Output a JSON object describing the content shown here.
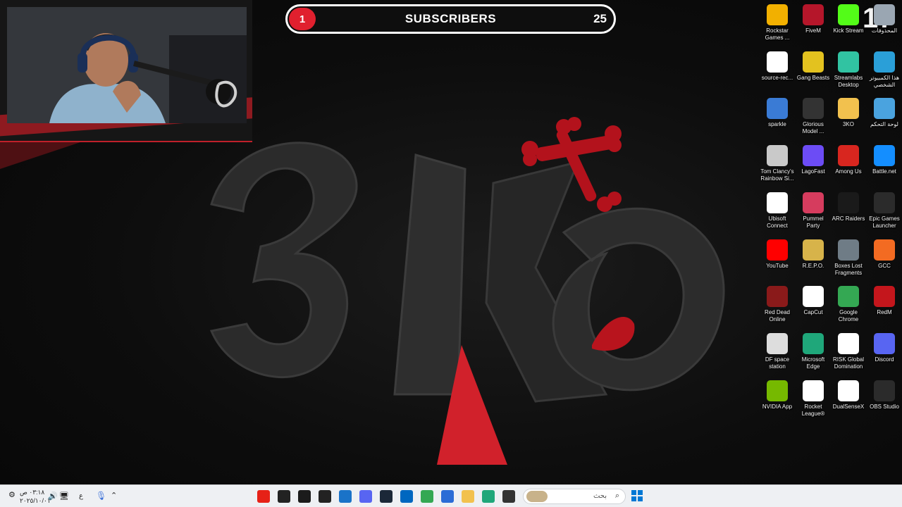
{
  "overlay": {
    "subscriber_label": "SUBSCRIBERS",
    "subscriber_badge": "1",
    "subscriber_goal": "25",
    "corner_counter": "17"
  },
  "desktop_icons": [
    {
      "label": "Rockstar Games ...",
      "icon": "rockstar-icon",
      "color": "#f2b000"
    },
    {
      "label": "FiveM",
      "icon": "fivem-icon",
      "color": "#b5162a"
    },
    {
      "label": "Kick Stream",
      "icon": "kick-icon",
      "color": "#53fc18"
    },
    {
      "label": "المحذوفات",
      "icon": "recycle-bin-icon",
      "color": "#9aa6b2"
    },
    {
      "label": "source-rec...",
      "icon": "source-record-icon",
      "color": "#ffffff"
    },
    {
      "label": "Gang Beasts",
      "icon": "gang-beasts-icon",
      "color": "#e3c21f"
    },
    {
      "label": "Streamlabs Desktop",
      "icon": "streamlabs-icon",
      "color": "#31c3a2"
    },
    {
      "label": "هذا الكمبيوتر الشخصي",
      "icon": "this-pc-icon",
      "color": "#2a9fd8"
    },
    {
      "label": "sparkle",
      "icon": "sparkle-icon",
      "color": "#3a7bd5"
    },
    {
      "label": "Glorious Model ...",
      "icon": "glorious-mouse-icon",
      "color": "#333333"
    },
    {
      "label": "3KO",
      "icon": "folder-icon",
      "color": "#f2c14e"
    },
    {
      "label": "لوحة التحكم",
      "icon": "control-panel-icon",
      "color": "#4aa3df"
    },
    {
      "label": "Tom Clancy's Rainbow Si...",
      "icon": "rainbow-six-icon",
      "color": "#c9c9c9"
    },
    {
      "label": "LagoFast",
      "icon": "lagofast-icon",
      "color": "#6c4cf5"
    },
    {
      "label": "Among Us",
      "icon": "among-us-icon",
      "color": "#d8261f"
    },
    {
      "label": "Battle.net",
      "icon": "battlenet-icon",
      "color": "#148eff"
    },
    {
      "label": "Ubisoft Connect",
      "icon": "ubisoft-icon",
      "color": "#ffffff"
    },
    {
      "label": "Pummel Party",
      "icon": "pummel-party-icon",
      "color": "#d63c5e"
    },
    {
      "label": "ARC Raiders",
      "icon": "arc-raiders-icon",
      "color": "#1a1a1a"
    },
    {
      "label": "Epic Games Launcher",
      "icon": "epic-games-icon",
      "color": "#2b2b2b"
    },
    {
      "label": "YouTube",
      "icon": "youtube-icon",
      "color": "#ff0000"
    },
    {
      "label": "R.E.P.O.",
      "icon": "repo-icon",
      "color": "#d7b34a"
    },
    {
      "label": "Boxes Lost Fragments",
      "icon": "boxes-icon",
      "color": "#6f7c86"
    },
    {
      "label": "GCC",
      "icon": "gcc-icon",
      "color": "#f36b22"
    },
    {
      "label": "Red Dead Online",
      "icon": "red-dead-icon",
      "color": "#8a1a1a"
    },
    {
      "label": "CapCut",
      "icon": "capcut-icon",
      "color": "#ffffff"
    },
    {
      "label": "Google Chrome",
      "icon": "chrome-icon",
      "color": "#34a853"
    },
    {
      "label": "RedM",
      "icon": "redm-icon",
      "color": "#c4161c"
    },
    {
      "label": "DF space station",
      "icon": "df-space-icon",
      "color": "#dddddd"
    },
    {
      "label": "Microsoft Edge",
      "icon": "edge-icon",
      "color": "#1fa77a"
    },
    {
      "label": "RISK Global Domination",
      "icon": "risk-icon",
      "color": "#ffffff"
    },
    {
      "label": "Discord",
      "icon": "discord-icon",
      "color": "#5865f2"
    },
    {
      "label": "NVIDIA App",
      "icon": "nvidia-icon",
      "color": "#76b900"
    },
    {
      "label": "Rocket League®",
      "icon": "rocket-league-icon",
      "color": "#ffffff"
    },
    {
      "label": "DualSenseX",
      "icon": "dualsensex-icon",
      "color": "#ffffff"
    },
    {
      "label": "OBS Studio",
      "icon": "obs-icon",
      "color": "#2b2b2b"
    }
  ],
  "taskbar": {
    "search_placeholder": "بحث",
    "clock_time": "٠٣:١٨ ص",
    "clock_date": "٢٠٢٥/١٠/٠١",
    "lang": "ع",
    "apps": [
      {
        "name": "youtube-taskbar-icon",
        "color": "#e62117"
      },
      {
        "name": "speedometer-taskbar-icon",
        "color": "#222222"
      },
      {
        "name": "recording-taskbar-icon",
        "color": "#1b1b1b"
      },
      {
        "name": "epic-taskbar-icon",
        "color": "#222222"
      },
      {
        "name": "edge-beta-taskbar-icon",
        "color": "#1a73c8"
      },
      {
        "name": "discord-taskbar-icon",
        "color": "#5865f2"
      },
      {
        "name": "steam-taskbar-icon",
        "color": "#1b2838"
      },
      {
        "name": "store-taskbar-icon",
        "color": "#0067c0"
      },
      {
        "name": "chrome-taskbar-icon",
        "color": "#34a853"
      },
      {
        "name": "copilot-taskbar-icon",
        "color": "#2b6cd6"
      },
      {
        "name": "file-explorer-taskbar-icon",
        "color": "#f2c14e"
      },
      {
        "name": "edge-taskbar-icon",
        "color": "#1fa77a"
      },
      {
        "name": "task-view-taskbar-icon",
        "color": "#333333"
      }
    ]
  }
}
